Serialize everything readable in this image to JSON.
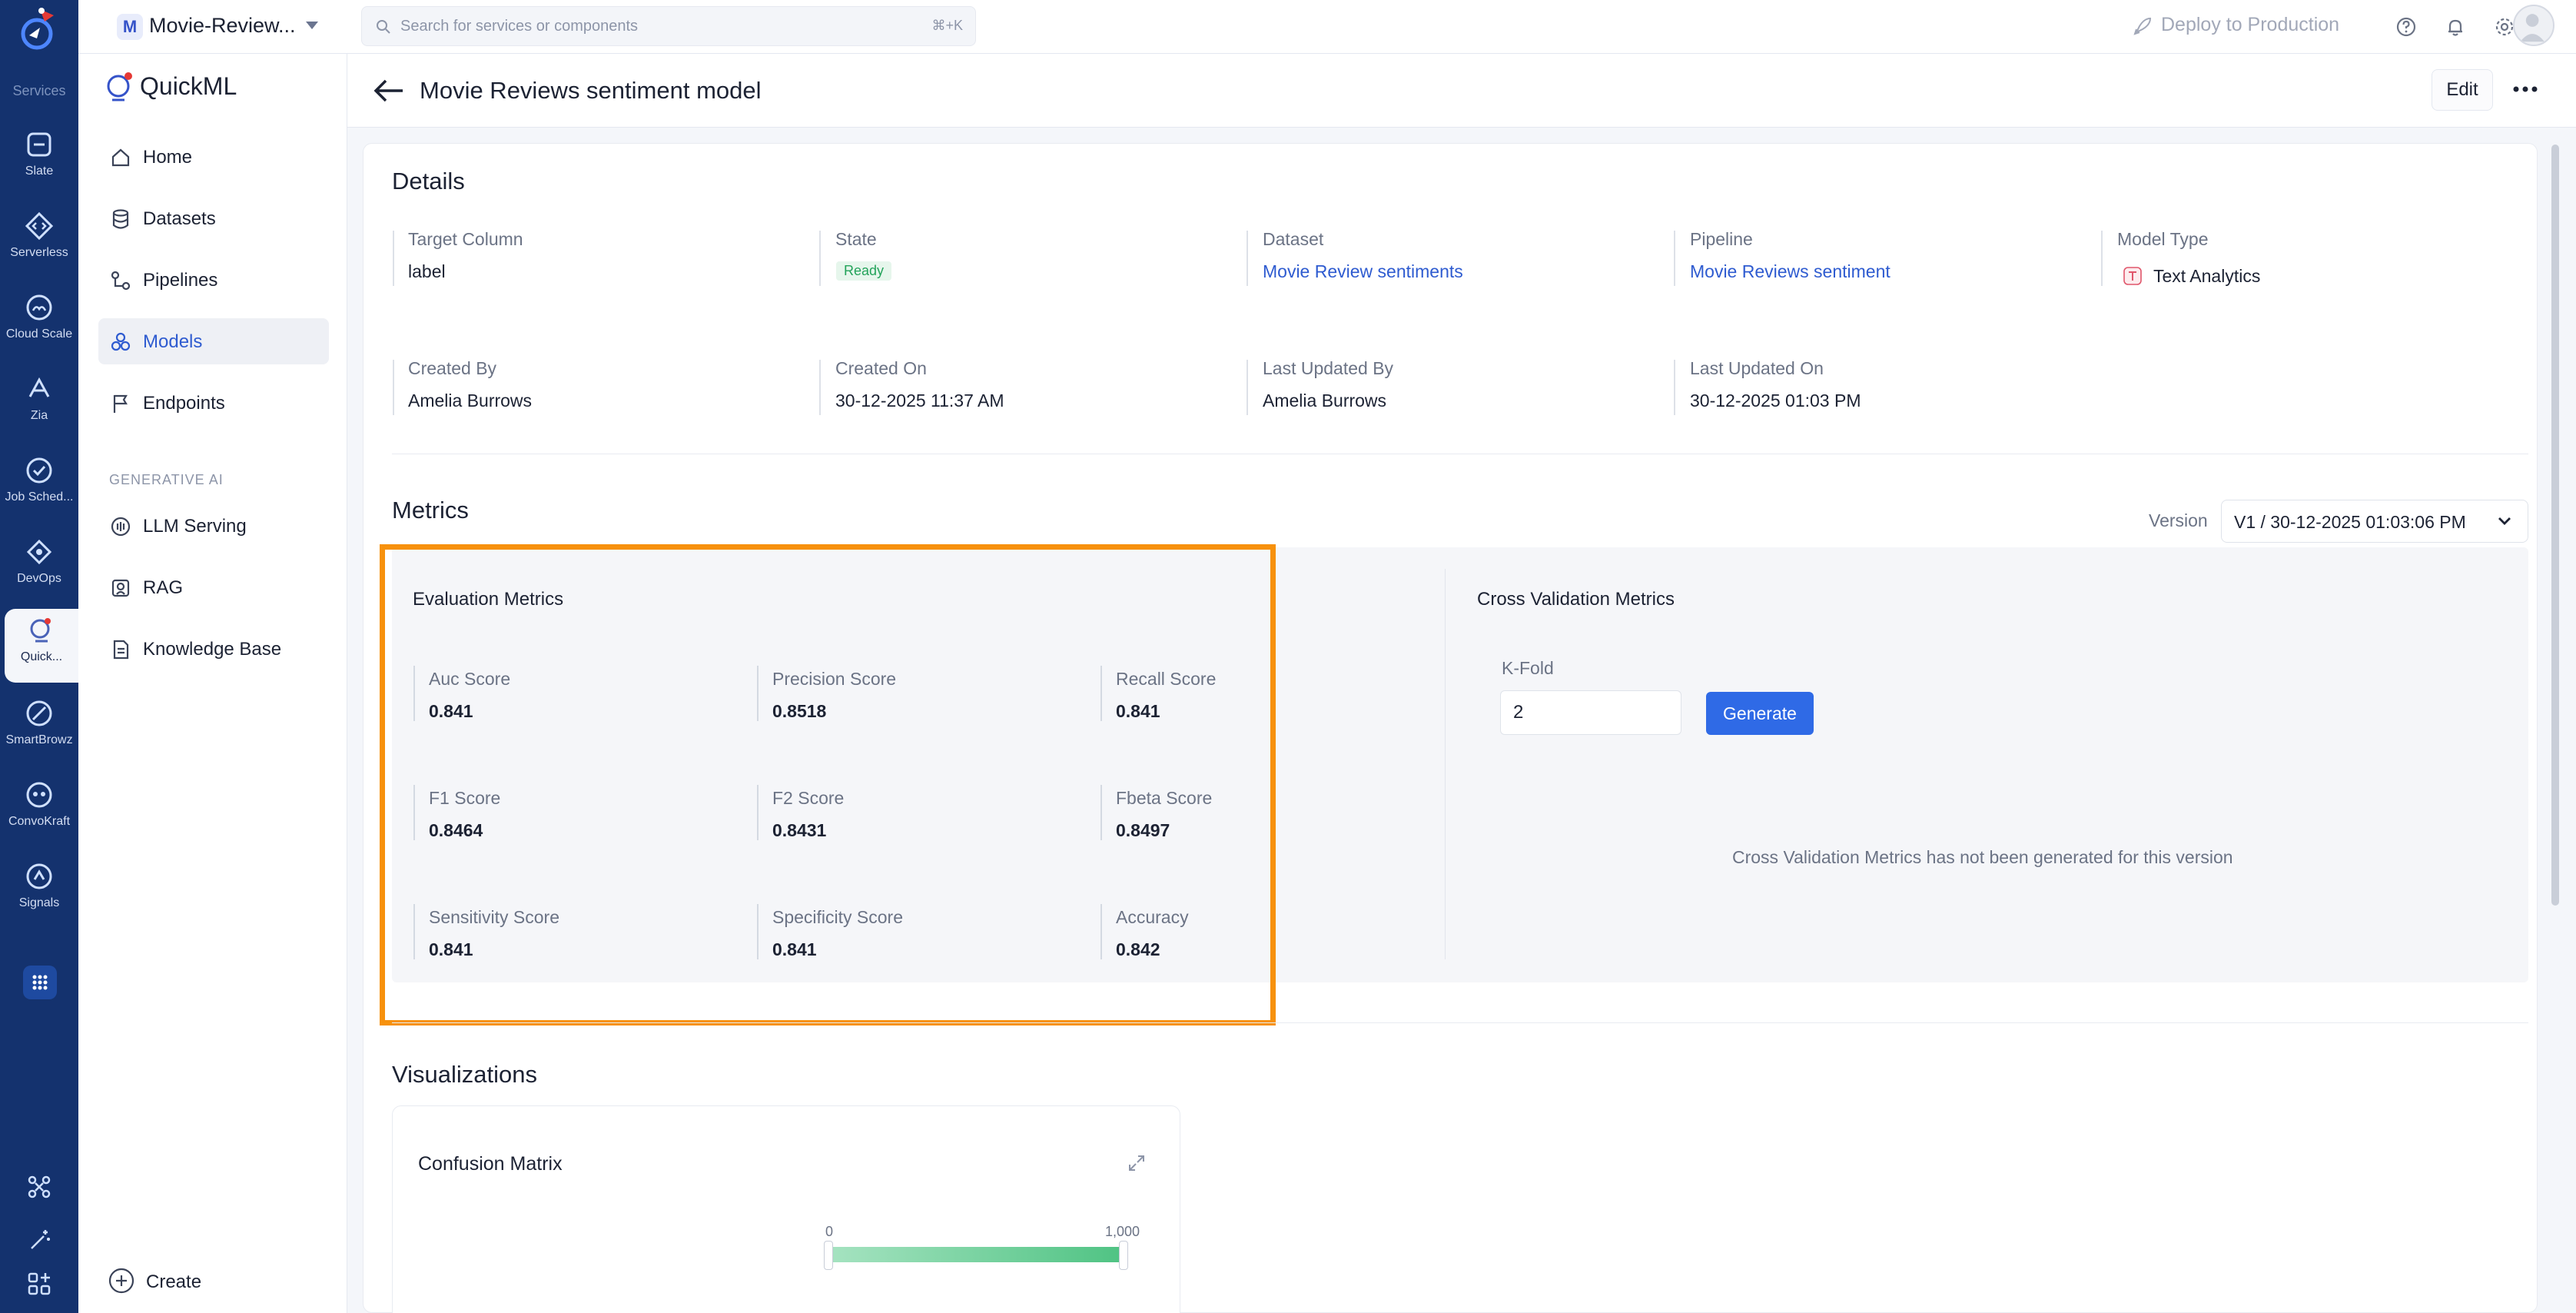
{
  "rail": {
    "services_label": "Services",
    "items": [
      {
        "label": "Slate",
        "icon": "slate-icon"
      },
      {
        "label": "Serverless",
        "icon": "serverless-icon"
      },
      {
        "label": "Cloud Scale",
        "icon": "cloud-scale-icon"
      },
      {
        "label": "Zia",
        "icon": "zia-icon"
      },
      {
        "label": "Job Sched...",
        "icon": "job-scheduler-icon"
      },
      {
        "label": "DevOps",
        "icon": "devops-icon"
      },
      {
        "label": "Quick...",
        "icon": "quickml-icon"
      },
      {
        "label": "SmartBrowz",
        "icon": "smartbrowz-icon"
      },
      {
        "label": "ConvoKraft",
        "icon": "convokraft-icon"
      },
      {
        "label": "Signals",
        "icon": "signals-icon"
      }
    ]
  },
  "topbar": {
    "project_initial": "M",
    "project_name": "Movie-Review...",
    "search_placeholder": "Search for services or components",
    "search_shortcut": "⌘+K",
    "deploy_label": "Deploy to Production"
  },
  "sidebar": {
    "brand": "QuickML",
    "items": [
      {
        "label": "Home"
      },
      {
        "label": "Datasets"
      },
      {
        "label": "Pipelines"
      },
      {
        "label": "Models"
      },
      {
        "label": "Endpoints"
      }
    ],
    "section_label": "GENERATIVE AI",
    "genai_items": [
      {
        "label": "LLM Serving"
      },
      {
        "label": "RAG"
      },
      {
        "label": "Knowledge Base"
      }
    ],
    "create_label": "Create"
  },
  "header": {
    "title": "Movie Reviews sentiment model",
    "edit_label": "Edit"
  },
  "details": {
    "title": "Details",
    "fields": [
      {
        "label": "Target Column",
        "value": "label"
      },
      {
        "label": "State",
        "value": "Ready"
      },
      {
        "label": "Dataset",
        "value": "Movie Review sentiments"
      },
      {
        "label": "Pipeline",
        "value": "Movie Reviews sentiment"
      },
      {
        "label": "Model Type",
        "value": "Text Analytics"
      },
      {
        "label": "Created By",
        "value": "Amelia Burrows"
      },
      {
        "label": "Created On",
        "value": "30-12-2025 11:37 AM"
      },
      {
        "label": "Last Updated By",
        "value": "Amelia Burrows"
      },
      {
        "label": "Last Updated On",
        "value": "30-12-2025 01:03 PM"
      }
    ]
  },
  "metrics": {
    "title": "Metrics",
    "version_label": "Version",
    "version_value": "V1 / 30-12-2025 01:03:06 PM",
    "evaluation": {
      "title": "Evaluation Metrics",
      "items": [
        {
          "label": "Auc Score",
          "value": "0.841"
        },
        {
          "label": "Precision Score",
          "value": "0.8518"
        },
        {
          "label": "Recall Score",
          "value": "0.841"
        },
        {
          "label": "F1 Score",
          "value": "0.8464"
        },
        {
          "label": "F2 Score",
          "value": "0.8431"
        },
        {
          "label": "Fbeta Score",
          "value": "0.8497"
        },
        {
          "label": "Sensitivity Score",
          "value": "0.841"
        },
        {
          "label": "Specificity Score",
          "value": "0.841"
        },
        {
          "label": "Accuracy",
          "value": "0.842"
        }
      ]
    },
    "cross_validation": {
      "title": "Cross Validation Metrics",
      "kfold_label": "K-Fold",
      "kfold_value": "2",
      "generate_label": "Generate",
      "empty_message": "Cross Validation Metrics has not been generated for this version"
    }
  },
  "visualizations": {
    "title": "Visualizations",
    "confusion_matrix_title": "Confusion Matrix",
    "range_min": "0",
    "range_max": "1,000"
  },
  "colors": {
    "rail_bg": "#14326e",
    "accent": "#2f6ae6",
    "link": "#2e5bd0",
    "ready": "#23a35a",
    "highlight": "#f7910c"
  }
}
